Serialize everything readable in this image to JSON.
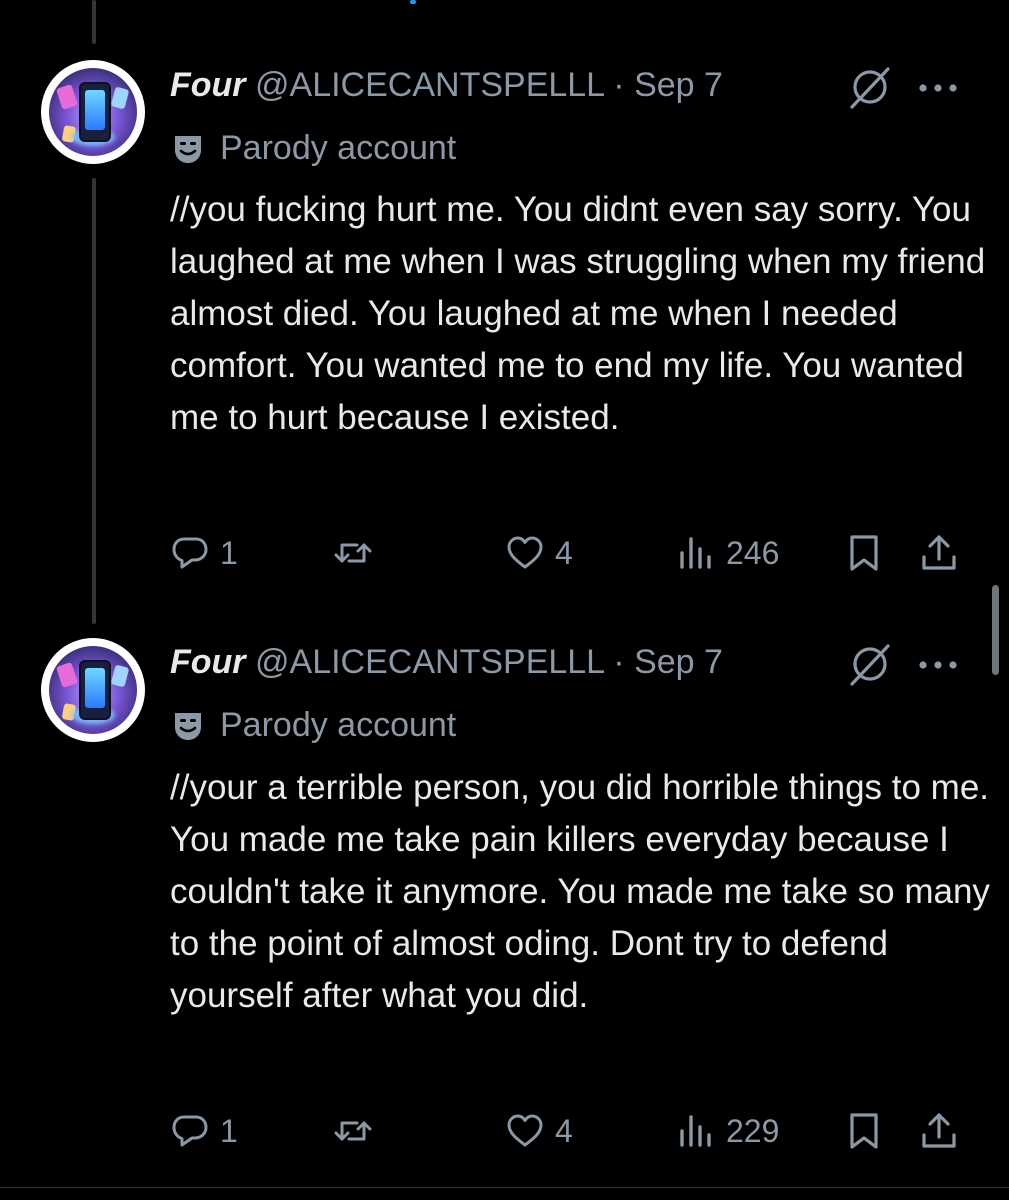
{
  "tweets": [
    {
      "display_name": "Four",
      "handle": "@ALICECANTSPELLL",
      "separator": "·",
      "date": "Sep 7",
      "badge_label": "Parody account",
      "text": "//you fucking hurt me. You didnt even say sorry. You laughed at me when I was struggling when my friend almost died. You laughed at me when I needed comfort. You wanted me to end my life. You wanted me to hurt because I existed.",
      "replies": "1",
      "likes": "4",
      "views": "246"
    },
    {
      "display_name": "Four",
      "handle": "@ALICECANTSPELLL",
      "separator": "·",
      "date": "Sep 7",
      "badge_label": "Parody account",
      "text": "//your a terrible person, you did horrible things to me. You made me take pain killers everyday because I couldn't take it anymore. You made me take so many to the point of almost oding. Dont try to defend yourself after what you did.",
      "replies": "1",
      "likes": "4",
      "views": "229"
    }
  ],
  "icons": {
    "reply": "reply-icon",
    "retweet": "retweet-icon",
    "like": "heart-icon",
    "views": "views-icon",
    "bookmark": "bookmark-icon",
    "share": "share-icon",
    "grok": "grok-icon",
    "more": "more-icon",
    "parody": "parody-mask-icon"
  },
  "colors": {
    "background": "#000000",
    "text_primary": "#e7e9ea",
    "text_secondary": "#8b98a5",
    "thread_line": "#333639"
  }
}
